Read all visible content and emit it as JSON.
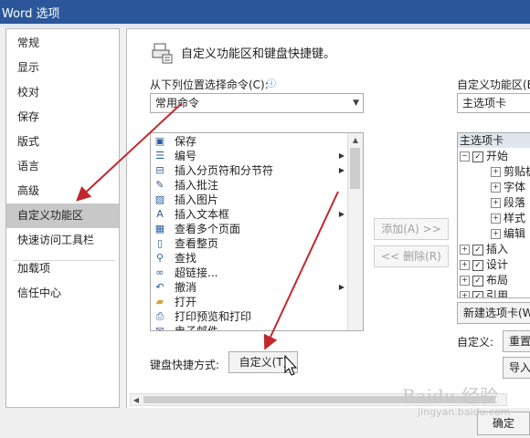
{
  "window": {
    "title": "Word 选项"
  },
  "nav": {
    "items": [
      {
        "label": "常规"
      },
      {
        "label": "显示"
      },
      {
        "label": "校对"
      },
      {
        "label": "保存"
      },
      {
        "label": "版式"
      },
      {
        "label": "语言"
      },
      {
        "label": "高级"
      },
      {
        "label": "自定义功能区",
        "selected": true
      },
      {
        "label": "快速访问工具栏"
      },
      {
        "label": "加载项"
      },
      {
        "label": "信任中心"
      }
    ]
  },
  "content": {
    "heading": "自定义功能区和键盘快捷键。",
    "choose_label": "从下列位置选择命令(C):",
    "choose_value": "常用命令",
    "customize_label": "自定义功能区(B",
    "customize_value": "主选项卡",
    "commands": [
      {
        "label": "保存",
        "icon": "save-icon",
        "glyph": "▣",
        "submenu": false
      },
      {
        "label": "编号",
        "icon": "numbering-icon",
        "glyph": "☰",
        "submenu": true
      },
      {
        "label": "插入分页符和分节符",
        "icon": "page-break-icon",
        "glyph": "⊟",
        "submenu": true
      },
      {
        "label": "插入批注",
        "icon": "comment-icon",
        "glyph": "✎",
        "submenu": false
      },
      {
        "label": "插入图片",
        "icon": "picture-icon",
        "glyph": "▨",
        "submenu": false
      },
      {
        "label": "插入文本框",
        "icon": "textbox-icon",
        "glyph": "A",
        "submenu": true
      },
      {
        "label": "查看多个页面",
        "icon": "multi-page-icon",
        "glyph": "▦",
        "submenu": false
      },
      {
        "label": "查看整页",
        "icon": "full-page-icon",
        "glyph": "▯",
        "submenu": false
      },
      {
        "label": "查找",
        "icon": "find-icon",
        "glyph": "⚲",
        "submenu": false
      },
      {
        "label": "超链接...",
        "icon": "hyperlink-icon",
        "glyph": "∞",
        "submenu": false
      },
      {
        "label": "撤消",
        "icon": "undo-icon",
        "glyph": "↶",
        "submenu": true
      },
      {
        "label": "打开",
        "icon": "open-folder-icon",
        "glyph": "▰",
        "submenu": false
      },
      {
        "label": "打印预览和打印",
        "icon": "print-preview-icon",
        "glyph": "⎙",
        "submenu": false
      },
      {
        "label": "电子邮件",
        "icon": "email-icon",
        "glyph": "✉",
        "submenu": false
      }
    ],
    "add_button": "添加(A) >>",
    "remove_button": "<< 删除(R)",
    "tree_header": "主选项卡",
    "tree": [
      {
        "label": "开始",
        "level": 0,
        "expander": "⊟",
        "checked": true
      },
      {
        "label": "剪贴板",
        "level": 1,
        "expander": "⊞",
        "checked": null
      },
      {
        "label": "字体",
        "level": 1,
        "expander": "⊞",
        "checked": null
      },
      {
        "label": "段落",
        "level": 1,
        "expander": "⊞",
        "checked": null
      },
      {
        "label": "样式",
        "level": 1,
        "expander": "⊞",
        "checked": null
      },
      {
        "label": "编辑",
        "level": 1,
        "expander": "⊞",
        "checked": null
      },
      {
        "label": "插入",
        "level": 0,
        "expander": "⊞",
        "checked": true
      },
      {
        "label": "设计",
        "level": 0,
        "expander": "⊞",
        "checked": true
      },
      {
        "label": "布局",
        "level": 0,
        "expander": "⊞",
        "checked": true
      },
      {
        "label": "引用",
        "level": 0,
        "expander": "⊞",
        "checked": true
      }
    ],
    "new_tab_button": "新建选项卡(W",
    "customizations_label": "自定义:",
    "reset_button": "重置",
    "import_button": "导入",
    "keyboard_label": "键盘快捷方式:",
    "keyboard_button": "自定义(T)",
    "ok_button": "确定"
  },
  "watermark": {
    "text": "Baidu 经验",
    "url_text": "jingyan.baidu.com"
  },
  "colors": {
    "titlebar": "#2b579a",
    "annotation_arrow": "#c0282d",
    "nav_selected": "#c8c8c8"
  }
}
